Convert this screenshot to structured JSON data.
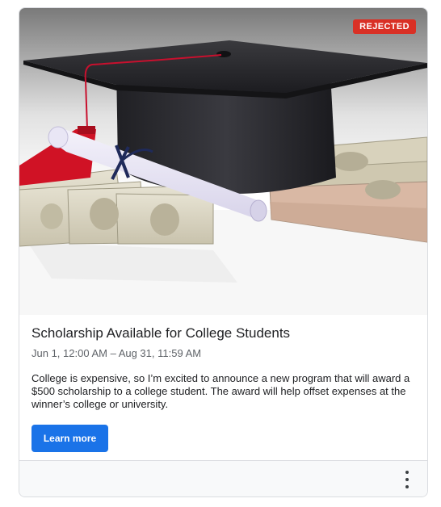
{
  "post": {
    "status_badge": "REJECTED",
    "title": "Scholarship Available for College Students",
    "date_range": "Jun 1, 12:00 AM – Aug 31, 11:59 AM",
    "description": "College is expensive, so I’m excited to announce a new program that will award a $500 scholarship to a college student. The award will help offset expenses at the winner’s college or university.",
    "cta_label": "Learn more",
    "image_subject": "graduation cap, diploma and dollar bills"
  },
  "colors": {
    "badge_red": "#d93025",
    "button_blue": "#1a73e8",
    "border": "#dadce0"
  },
  "icons": {
    "overflow_menu": "more-vert-icon"
  }
}
